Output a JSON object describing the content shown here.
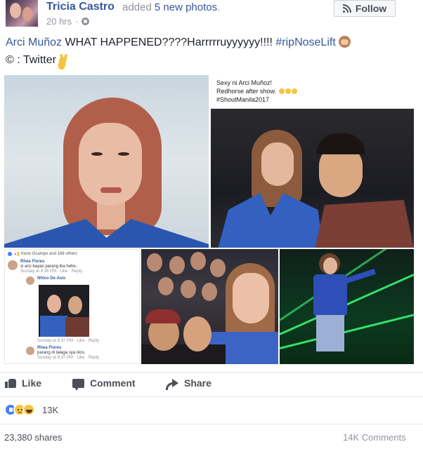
{
  "post": {
    "author": "Tricia Castro",
    "action_prefix": "added",
    "action_link": "5 new photos",
    "action_suffix": ".",
    "time": "20 hrs",
    "follow_label": "Follow",
    "caption_mention": "Arci Muñoz",
    "caption_text": " WHAT HAPPENED????Harrrrruyyyyyy!!!! ",
    "caption_hashtag": "#ripNoseLift",
    "source_text": "©︎ : Twitter"
  },
  "photos": {
    "photo2_tweet": {
      "line1": "Sexy ni Arci Muñoz!",
      "line2": "Redhorse after show.",
      "line3": "#ShoutManila2017"
    },
    "photo3": {
      "reaction_line": "Keno Ocampo and 168 others",
      "comment1_name": "Rhea Flores",
      "comment1_text": "si arci bayan parang iba hehe..",
      "comment1_time": "Sunday at 8:36 PM · Like · Reply · ",
      "comment2_name": "Nhico De Asis",
      "comment2_time": "Sunday at 8:37 PM · Like · Reply · ",
      "comment3_name": "Rhea Flores",
      "comment3_text": "parang di talaga sya nico.",
      "comment3_time": "Sunday at 8:37 PM · Like · Reply"
    }
  },
  "actions": {
    "like_label": "Like",
    "comment_label": "Comment",
    "share_label": "Share"
  },
  "stats": {
    "reaction_count": "13K",
    "shares": "23,380 shares",
    "comments": "14K Comments"
  },
  "icons": {
    "follow": "rss-icon",
    "privacy": "globe-icon",
    "like": "thumbs-up-icon",
    "comment": "speech-bubble-icon",
    "share": "share-arrow-icon",
    "reactions": [
      "like-reaction-icon",
      "sad-reaction-icon",
      "haha-reaction-icon"
    ]
  },
  "colors": {
    "link": "#365899",
    "meta": "#90949c",
    "text": "#1d2129",
    "action_text": "#4b4f56",
    "like_blue": "#4080ff",
    "emoji_yellow": "#f6c445"
  }
}
